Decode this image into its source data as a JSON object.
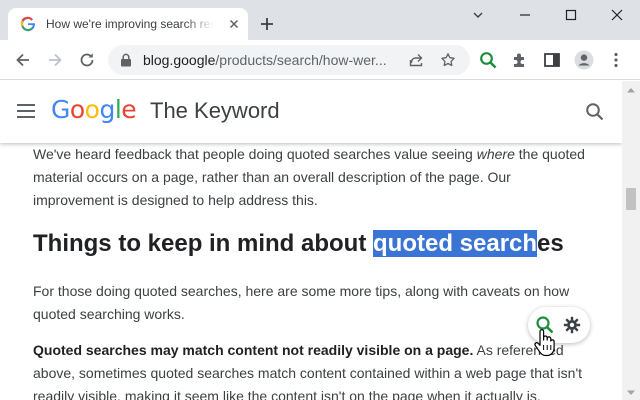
{
  "browser": {
    "tab": {
      "title": "How we're improving search results when you use quotes"
    },
    "address": {
      "url_main": "blog.google",
      "url_path": "/products/search/how-wer..."
    },
    "colors": {
      "accent_green": "#1e8e3e",
      "selection": "#3a75d6"
    }
  },
  "site": {
    "logo": [
      "G",
      "o",
      "o",
      "g",
      "l",
      "e"
    ],
    "logo_colors": [
      "#4285f4",
      "#ea4335",
      "#fbbc05",
      "#4285f4",
      "#34a853",
      "#ea4335"
    ],
    "name": "The Keyword"
  },
  "article": {
    "p1_before": "We've heard feedback that people doing quoted searches value seeing ",
    "p1_em": "where",
    "p1_after": " the quoted material occurs on a page, rather than an overall description of the page. Our improvement is designed to help address this.",
    "heading_before": "Things to keep in mind about ",
    "heading_selected": "quoted search",
    "heading_after": "es",
    "p2": "For those doing quoted searches, here are some more tips, along with caveats on how quoted searching works.",
    "p3_bold": "Quoted searches may match content not readily visible on a page.",
    "p3_text": " As referenced above, sometimes quoted searches match content contained within a web page that isn't readily visible, making it seem like the content isn't on the page when it actually is."
  }
}
